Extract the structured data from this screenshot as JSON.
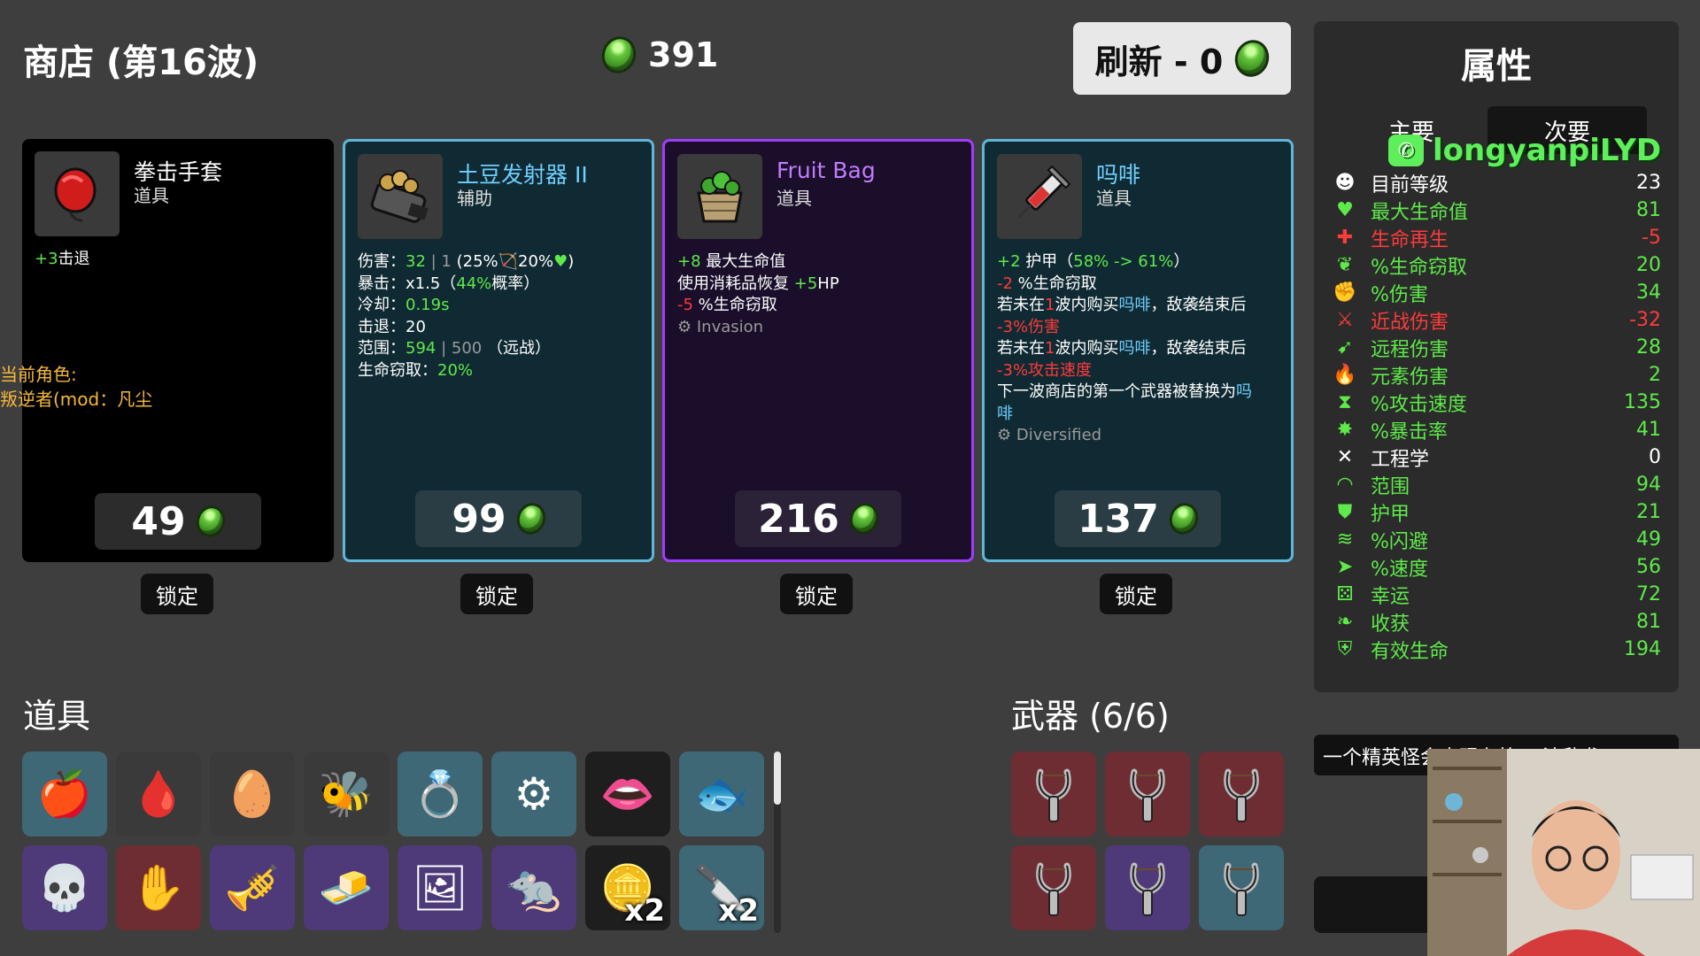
{
  "header": {
    "shop_title": "商店 (第16波)",
    "currency": "391",
    "refresh_label": "刷新 - 0"
  },
  "shop": [
    {
      "name": "拳击手套",
      "type": "道具",
      "icon": "boxing-glove-icon",
      "rarity": "common",
      "desc": [
        {
          "parts": [
            {
              "t": "+3",
              "c": "g"
            },
            {
              "t": "击退",
              "c": ""
            }
          ]
        }
      ],
      "price": "49",
      "lock_label": "锁定"
    },
    {
      "name": "土豆发射器 II",
      "type": "辅助",
      "icon": "potato-launcher-icon",
      "rarity": "uncommon",
      "desc": [
        {
          "parts": [
            {
              "t": "伤害：",
              "c": ""
            },
            {
              "t": "32",
              "c": "g"
            },
            {
              "t": " | 1 ",
              "c": "mut"
            },
            {
              "t": "(25%",
              "c": ""
            },
            {
              "t": "🏹",
              "c": "pu"
            },
            {
              "t": "20%",
              "c": ""
            },
            {
              "t": "♥",
              "c": "g"
            },
            {
              "t": ")",
              "c": ""
            }
          ]
        },
        {
          "parts": [
            {
              "t": "暴击：",
              "c": ""
            },
            {
              "t": "x1.5",
              "c": ""
            },
            {
              "t": "（",
              "c": ""
            },
            {
              "t": "44%",
              "c": "g"
            },
            {
              "t": "概率）",
              "c": ""
            }
          ]
        },
        {
          "parts": [
            {
              "t": "冷却：",
              "c": ""
            },
            {
              "t": "0.19s",
              "c": "g"
            }
          ]
        },
        {
          "parts": [
            {
              "t": "击退：",
              "c": ""
            },
            {
              "t": "20",
              "c": ""
            }
          ]
        },
        {
          "parts": [
            {
              "t": "范围：",
              "c": ""
            },
            {
              "t": "594",
              "c": "g"
            },
            {
              "t": " | 500 ",
              "c": "mut"
            },
            {
              "t": "（远战）",
              "c": ""
            }
          ]
        },
        {
          "parts": [
            {
              "t": "生命窃取：",
              "c": ""
            },
            {
              "t": "20%",
              "c": "g"
            }
          ]
        }
      ],
      "price": "99",
      "lock_label": "锁定"
    },
    {
      "name": "Fruit Bag",
      "type": "道具",
      "icon": "fruit-bag-icon",
      "rarity": "rare",
      "desc": [
        {
          "parts": [
            {
              "t": "+8",
              "c": "g"
            },
            {
              "t": " 最大生命值",
              "c": ""
            }
          ]
        },
        {
          "parts": [
            {
              "t": "使用消耗品恢复 ",
              "c": ""
            },
            {
              "t": "+5",
              "c": "g"
            },
            {
              "t": "HP",
              "c": ""
            }
          ]
        },
        {
          "parts": [
            {
              "t": "-5",
              "c": "r"
            },
            {
              "t": " %生命窃取",
              "c": ""
            }
          ]
        },
        {
          "parts": [
            {
              "t": "⚙ Invasion",
              "c": "mut"
            }
          ]
        }
      ],
      "price": "216",
      "lock_label": "锁定"
    },
    {
      "name": "吗啡",
      "type": "道具",
      "icon": "syringe-icon",
      "rarity": "uncommon",
      "desc": [
        {
          "parts": [
            {
              "t": "+2",
              "c": "g"
            },
            {
              "t": " 护甲（",
              "c": ""
            },
            {
              "t": "58% -> 61%",
              "c": "g"
            },
            {
              "t": "）",
              "c": ""
            }
          ]
        },
        {
          "parts": [
            {
              "t": "-2",
              "c": "r"
            },
            {
              "t": " %生命窃取",
              "c": ""
            }
          ]
        },
        {
          "parts": [
            {
              "t": "若未在",
              "c": ""
            },
            {
              "t": "1",
              "c": "r"
            },
            {
              "t": "波内购买",
              "c": ""
            },
            {
              "t": "吗啡",
              "c": "bl"
            },
            {
              "t": "，敌袭结束后",
              "c": ""
            }
          ]
        },
        {
          "parts": [
            {
              "t": "-3%伤害",
              "c": "r"
            }
          ]
        },
        {
          "parts": [
            {
              "t": "若未在",
              "c": ""
            },
            {
              "t": "1",
              "c": "r"
            },
            {
              "t": "波内购买",
              "c": ""
            },
            {
              "t": "吗啡",
              "c": "bl"
            },
            {
              "t": "，敌袭结束后",
              "c": ""
            }
          ]
        },
        {
          "parts": [
            {
              "t": "-3%攻击速度",
              "c": "r"
            }
          ]
        },
        {
          "parts": [
            {
              "t": "下一波商店的第一个武器被替换为",
              "c": ""
            },
            {
              "t": "吗",
              "c": "bl"
            }
          ]
        },
        {
          "parts": [
            {
              "t": "啡",
              "c": "bl"
            }
          ]
        },
        {
          "parts": [
            {
              "t": "⚙ Diversified",
              "c": "mut"
            }
          ]
        }
      ],
      "price": "137",
      "lock_label": "锁定"
    }
  ],
  "character_note": {
    "line1": "当前角色:",
    "line2": "叛逆者(mod：凡尘"
  },
  "items_section": {
    "title": "道具",
    "items": [
      {
        "icon": "apple-icon",
        "glyph": "🍎",
        "bg": "s-blue",
        "qty": ""
      },
      {
        "icon": "blood-drop-icon",
        "glyph": "🩸",
        "bg": "s-grey",
        "qty": ""
      },
      {
        "icon": "egg-face-icon",
        "glyph": "🥚",
        "bg": "s-grey",
        "qty": ""
      },
      {
        "icon": "bee-icon",
        "glyph": "🐝",
        "bg": "s-grey",
        "qty": ""
      },
      {
        "icon": "ring-icon",
        "glyph": "💍",
        "bg": "s-blue",
        "qty": ""
      },
      {
        "icon": "machine-icon",
        "glyph": "⚙",
        "bg": "s-blue",
        "qty": ""
      },
      {
        "icon": "mouth-icon",
        "glyph": "👄",
        "bg": "s-dark",
        "qty": ""
      },
      {
        "icon": "fish-icon",
        "glyph": "🐟",
        "bg": "s-blue",
        "qty": ""
      },
      {
        "icon": "skull-spider-icon",
        "glyph": "💀",
        "bg": "s-purple",
        "qty": ""
      },
      {
        "icon": "bloody-hand-icon",
        "glyph": "✋",
        "bg": "s-red",
        "qty": ""
      },
      {
        "icon": "horn-icon",
        "glyph": "🎺",
        "bg": "s-purple",
        "qty": ""
      },
      {
        "icon": "gold-bar-icon",
        "glyph": "🧈",
        "bg": "s-purple",
        "qty": ""
      },
      {
        "icon": "portrait-icon",
        "glyph": "🖼",
        "bg": "s-purple",
        "qty": ""
      },
      {
        "icon": "rat-icon",
        "glyph": "🐀",
        "bg": "s-purple",
        "qty": ""
      },
      {
        "icon": "bolt-coin-icon",
        "glyph": "🪙",
        "bg": "s-dark",
        "qty": "x2"
      },
      {
        "icon": "claw-icon",
        "glyph": "🔪",
        "bg": "s-blue",
        "qty": "x2"
      }
    ]
  },
  "weapons_section": {
    "title": "武器 (6/6)",
    "weapons": [
      {
        "icon": "slingshot-icon",
        "bg": "s-red"
      },
      {
        "icon": "slingshot-icon",
        "bg": "s-red"
      },
      {
        "icon": "slingshot-icon",
        "bg": "s-red"
      },
      {
        "icon": "slingshot-icon",
        "bg": "s-red"
      },
      {
        "icon": "slingshot-icon",
        "bg": "s-purple"
      },
      {
        "icon": "slingshot-icon",
        "bg": "s-blue"
      }
    ]
  },
  "stats_panel": {
    "title": "属性",
    "tab_main": "主要",
    "tab_secondary": "次要",
    "stats": [
      {
        "icon": "level-icon",
        "glyph": "☻",
        "label": "目前等级",
        "value": "23",
        "color": "#ffffff"
      },
      {
        "icon": "heart-icon",
        "glyph": "♥",
        "label": "最大生命值",
        "value": "81",
        "color": "#5eea4a"
      },
      {
        "icon": "regen-icon",
        "glyph": "✚",
        "label": "生命再生",
        "value": "-5",
        "color": "#ff3a3a"
      },
      {
        "icon": "lifesteal-icon",
        "glyph": "❦",
        "label": "%生命窃取",
        "value": "20",
        "color": "#5eea4a"
      },
      {
        "icon": "damage-icon",
        "glyph": "✊",
        "label": "%伤害",
        "value": "34",
        "color": "#5eea4a"
      },
      {
        "icon": "melee-icon",
        "glyph": "⚔",
        "label": "近战伤害",
        "value": "-32",
        "color": "#ff3a3a"
      },
      {
        "icon": "ranged-icon",
        "glyph": "➹",
        "label": "远程伤害",
        "value": "28",
        "color": "#5eea4a"
      },
      {
        "icon": "elemental-icon",
        "glyph": "🔥",
        "label": "元素伤害",
        "value": "2",
        "color": "#5eea4a"
      },
      {
        "icon": "attack-speed-icon",
        "glyph": "⧗",
        "label": "%攻击速度",
        "value": "135",
        "color": "#5eea4a"
      },
      {
        "icon": "crit-icon",
        "glyph": "✸",
        "label": "%暴击率",
        "value": "41",
        "color": "#5eea4a"
      },
      {
        "icon": "engineering-icon",
        "glyph": "✕",
        "label": "工程学",
        "value": "0",
        "color": "#ffffff"
      },
      {
        "icon": "range-icon",
        "glyph": "◠",
        "label": "范围",
        "value": "94",
        "color": "#5eea4a"
      },
      {
        "icon": "armor-icon",
        "glyph": "⛊",
        "label": "护甲",
        "value": "21",
        "color": "#5eea4a"
      },
      {
        "icon": "dodge-icon",
        "glyph": "≋",
        "label": "%闪避",
        "value": "49",
        "color": "#5eea4a"
      },
      {
        "icon": "speed-icon",
        "glyph": "➤",
        "label": "%速度",
        "value": "56",
        "color": "#5eea4a"
      },
      {
        "icon": "luck-icon",
        "glyph": "⚄",
        "label": "幸运",
        "value": "72",
        "color": "#5eea4a"
      },
      {
        "icon": "harvest-icon",
        "glyph": "❧",
        "label": "收获",
        "value": "81",
        "color": "#5eea4a"
      },
      {
        "icon": "effective-hp-icon",
        "glyph": "⛨",
        "label": "有效生命",
        "value": "194",
        "color": "#5eea4a"
      }
    ]
  },
  "watermark": "longyanpiLYD",
  "toast": "一个精英怪会出现在第17波敌袭",
  "colors": {
    "background": "#3e3e3e",
    "uncommon_border": "#5fb6d9",
    "rare_border": "#a13cff",
    "positive": "#5eea4a",
    "negative": "#ff3a3a"
  }
}
